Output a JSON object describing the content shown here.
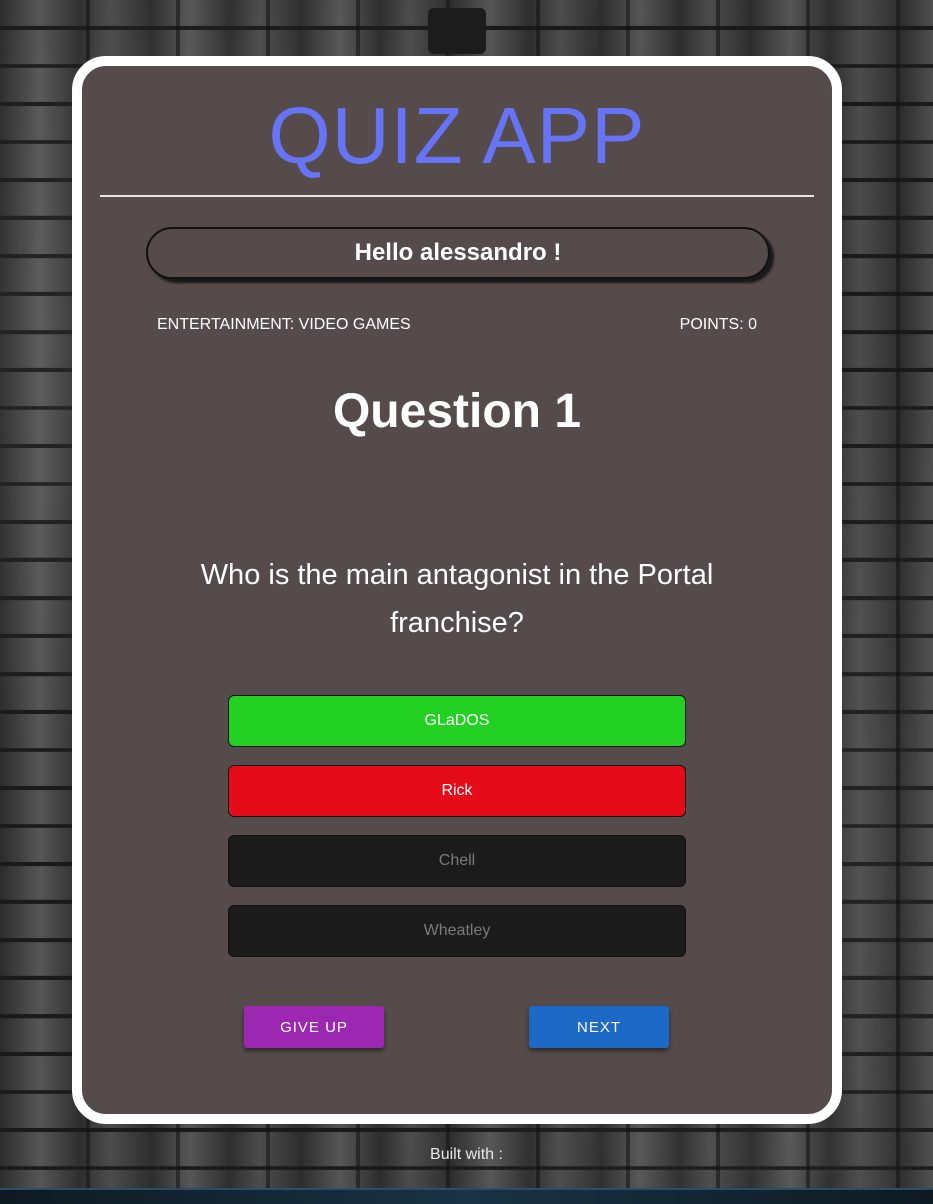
{
  "theme_toggle": {
    "icon": "moon-icon"
  },
  "header": {
    "title": "QUIZ APP"
  },
  "greeting": "Hello alessandro !",
  "quiz": {
    "category": "ENTERTAINMENT: VIDEO GAMES",
    "points": "POINTS: 0",
    "question_heading": "Question 1",
    "question_text": "Who is the main antagonist in the Portal franchise?",
    "answers": [
      {
        "label": "GLaDOS",
        "state": "correct",
        "color": "#23d123"
      },
      {
        "label": "Rick",
        "state": "wrong",
        "color": "#e60b19"
      },
      {
        "label": "Chell",
        "state": "disabled",
        "color": "#1b1b1b"
      },
      {
        "label": "Wheatley",
        "state": "disabled",
        "color": "#1b1b1b"
      }
    ]
  },
  "actions": {
    "give_up_label": "GIVE UP",
    "next_label": "NEXT"
  },
  "footer": {
    "built_with": "Built with :"
  },
  "colors": {
    "title": "#6674f5",
    "card_bg": "#544b4a",
    "give_up": "#9c27b0",
    "next": "#1c6ac5"
  }
}
